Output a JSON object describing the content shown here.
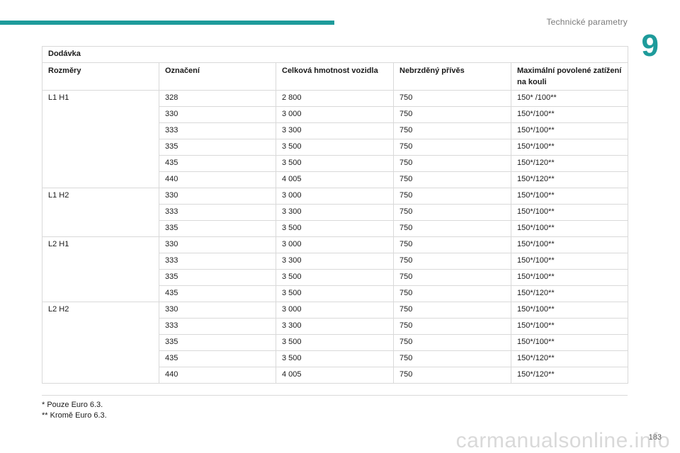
{
  "header": {
    "section_title": "Technické parametry",
    "chapter_number": "9",
    "accent_color": "#1e9b9b"
  },
  "table": {
    "title": "Dodávka",
    "columns": [
      "Rozměry",
      "Označení",
      "Celková hmotnost vozidla",
      "Nebrzděný přívěs",
      "Maximální povolené zatížení na kouli"
    ],
    "groups": [
      {
        "dimension": "L1 H1",
        "rows": [
          [
            "328",
            "2 800",
            "750",
            "150* /100**"
          ],
          [
            "330",
            "3 000",
            "750",
            "150*/100**"
          ],
          [
            "333",
            "3 300",
            "750",
            "150*/100**"
          ],
          [
            "335",
            "3 500",
            "750",
            "150*/100**"
          ],
          [
            "435",
            "3 500",
            "750",
            "150*/120**"
          ],
          [
            "440",
            "4 005",
            "750",
            "150*/120**"
          ]
        ]
      },
      {
        "dimension": "L1 H2",
        "rows": [
          [
            "330",
            "3 000",
            "750",
            "150*/100**"
          ],
          [
            "333",
            "3 300",
            "750",
            "150*/100**"
          ],
          [
            "335",
            "3 500",
            "750",
            "150*/100**"
          ]
        ]
      },
      {
        "dimension": "L2 H1",
        "rows": [
          [
            "330",
            "3 000",
            "750",
            "150*/100**"
          ],
          [
            "333",
            "3 300",
            "750",
            "150*/100**"
          ],
          [
            "335",
            "3 500",
            "750",
            "150*/100**"
          ],
          [
            "435",
            "3 500",
            "750",
            "150*/120**"
          ]
        ]
      },
      {
        "dimension": "L2 H2",
        "rows": [
          [
            "330",
            "3 000",
            "750",
            "150*/100**"
          ],
          [
            "333",
            "3 300",
            "750",
            "150*/100**"
          ],
          [
            "335",
            "3 500",
            "750",
            "150*/100**"
          ],
          [
            "435",
            "3 500",
            "750",
            "150*/120**"
          ],
          [
            "440",
            "4 005",
            "750",
            "150*/120**"
          ]
        ]
      }
    ]
  },
  "footnotes": [
    "* Pouze Euro 6.3.",
    "** Kromě Euro 6.3."
  ],
  "page_number": "183",
  "watermark": "carmanualsonline.info"
}
